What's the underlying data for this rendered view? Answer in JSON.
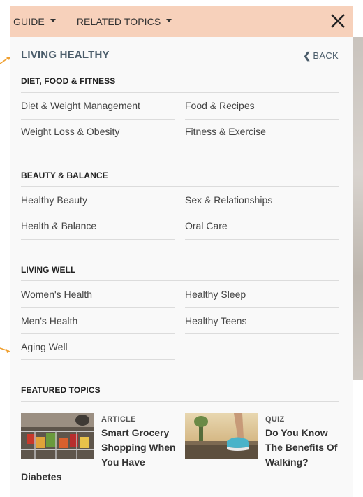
{
  "topbar": {
    "guide_label": "GUIDE",
    "related_label": "RELATED TOPICS",
    "close_icon": "close-x-icon"
  },
  "panel": {
    "title": "LIVING HEALTHY",
    "back_label": "BACK"
  },
  "sections": [
    {
      "heading": "DIET, FOOD & FITNESS",
      "links": [
        "Diet & Weight Management",
        "Food & Recipes",
        "Weight Loss & Obesity",
        "Fitness & Exercise"
      ]
    },
    {
      "heading": "BEAUTY & BALANCE",
      "links": [
        "Healthy Beauty",
        "Sex & Relationships",
        "Health & Balance",
        "Oral Care"
      ]
    },
    {
      "heading": "LIVING WELL",
      "links": [
        "Women's Health",
        "Healthy Sleep",
        "Men's Health",
        "Healthy Teens",
        "Aging Well"
      ]
    }
  ],
  "featured": {
    "heading": "FEATURED TOPICS",
    "items": [
      {
        "type": "ARTICLE",
        "title_lines": [
          "Smart Grocery",
          "Shopping When",
          "You Have"
        ],
        "title_overflow": "Diabetes",
        "image_icon": "grocery-cart-photo"
      },
      {
        "type": "QUIZ",
        "title_lines": [
          "Do You Know",
          "The Benefits Of",
          "Walking?"
        ],
        "image_icon": "walking-shoes-photo"
      }
    ]
  },
  "colors": {
    "topbar_bg": "#f7d1bb",
    "panel_bg": "#f9f9f9",
    "title_color": "#4a5c6a",
    "arrow_color": "#f0a030"
  }
}
